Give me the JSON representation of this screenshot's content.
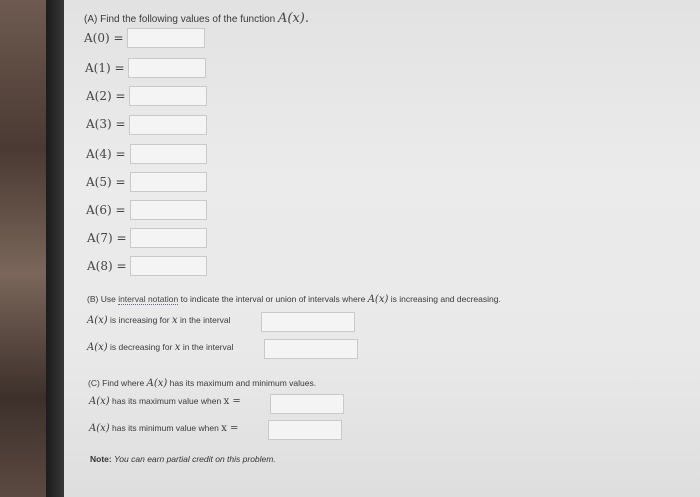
{
  "partA": {
    "header": "(A) Find the following values of the function",
    "func_label": "A(x).",
    "rows": [
      {
        "label": "A(0) =",
        "value": ""
      },
      {
        "label": "A(1) =",
        "value": ""
      },
      {
        "label": "A(2) =",
        "value": ""
      },
      {
        "label": "A(3) =",
        "value": ""
      },
      {
        "label": "A(4) =",
        "value": ""
      },
      {
        "label": "A(5) =",
        "value": ""
      },
      {
        "label": "A(6) =",
        "value": ""
      },
      {
        "label": "A(7) =",
        "value": ""
      },
      {
        "label": "A(8) =",
        "value": ""
      }
    ]
  },
  "partB": {
    "header_prefix": "(B) Use",
    "link": "interval notation",
    "header_mid": "to indicate the interval or union of intervals where",
    "func": "A(x)",
    "header_suffix": "is increasing and decreasing.",
    "increasing_func": "A(x)",
    "increasing_text": "is increasing for",
    "decreasing_func": "A(x)",
    "decreasing_text": "is decreasing for",
    "var": "x",
    "interval_text": "in the interval",
    "increasing_value": "",
    "decreasing_value": ""
  },
  "partC": {
    "header_prefix": "(C) Find where",
    "func": "A(x)",
    "header_suffix": "has its maximum and minimum values.",
    "max_func": "A(x)",
    "max_text": "has its maximum value when",
    "min_func": "A(x)",
    "min_text": "has its minimum value when",
    "var_eq": "x =",
    "max_value": "",
    "min_value": ""
  },
  "note": {
    "label": "Note:",
    "text": "You can earn partial credit on this problem."
  }
}
